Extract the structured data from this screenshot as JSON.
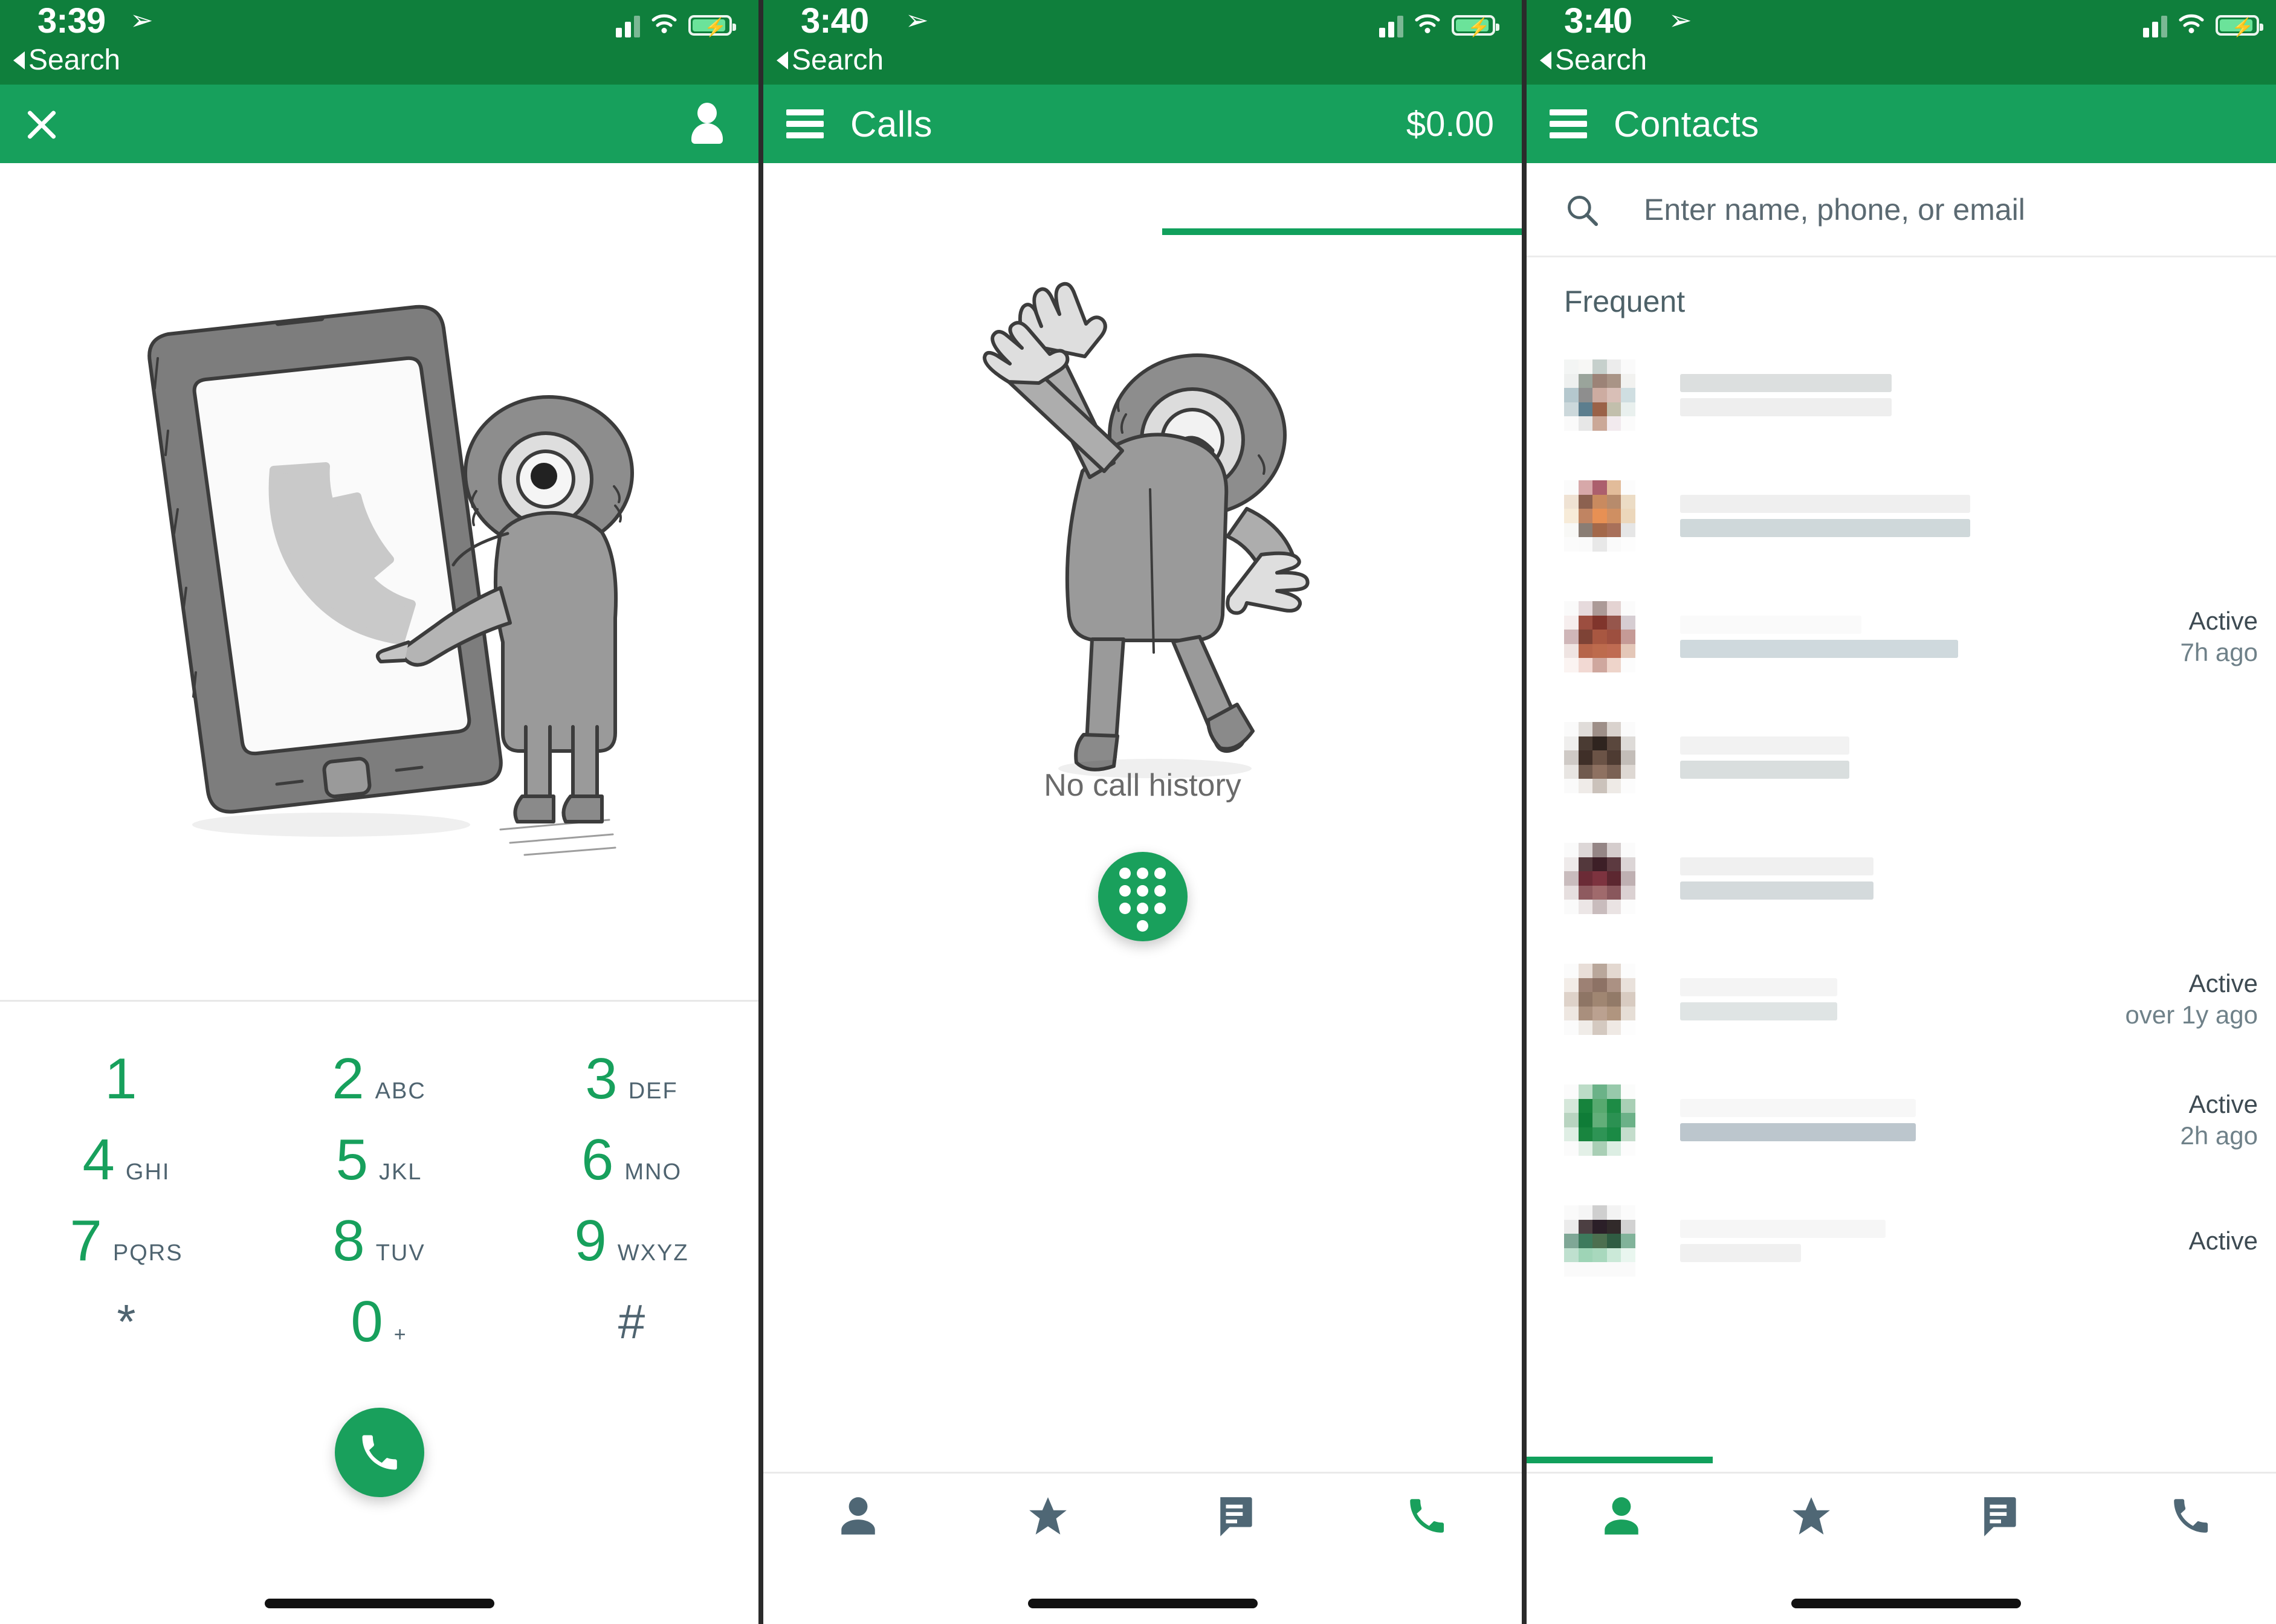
{
  "colors": {
    "status_bar_green": "#0F7F3C",
    "app_bar_green": "#17A05C",
    "accent_green": "#19A05C",
    "tab_inactive": "#4F6775",
    "text_muted": "#6a6a6a"
  },
  "panels": [
    {
      "id": "dialer",
      "status": {
        "time": "3:39",
        "back_label": "Search",
        "location_icon": "location-arrow-icon",
        "signal_icon": "cellular-signal-icon",
        "wifi_icon": "wifi-icon",
        "battery_icon": "battery-charging-icon"
      },
      "appbar": {
        "close_icon": "close-icon",
        "person_icon": "person-icon",
        "title": ""
      },
      "illustration": "person-pointing-at-phone-illustration",
      "dialpad": {
        "keys": [
          {
            "num": "1",
            "letters": ""
          },
          {
            "num": "2",
            "letters": "ABC"
          },
          {
            "num": "3",
            "letters": "DEF"
          },
          {
            "num": "4",
            "letters": "GHI"
          },
          {
            "num": "5",
            "letters": "JKL"
          },
          {
            "num": "6",
            "letters": "MNO"
          },
          {
            "num": "7",
            "letters": "PQRS"
          },
          {
            "num": "8",
            "letters": "TUV"
          },
          {
            "num": "9",
            "letters": "WXYZ"
          },
          {
            "num": "*",
            "letters": ""
          },
          {
            "num": "0",
            "letters": "+"
          },
          {
            "num": "#",
            "letters": ""
          }
        ],
        "call_button_icon": "phone-call-icon"
      }
    },
    {
      "id": "calls",
      "status": {
        "time": "3:40",
        "back_label": "Search"
      },
      "appbar": {
        "menu_icon": "hamburger-menu-icon",
        "title": "Calls",
        "balance": "$0.00"
      },
      "illustration": "celebrating-character-illustration",
      "empty_state": "No call history",
      "fab": {
        "icon": "dialpad-icon"
      },
      "tabs": [
        {
          "name": "contacts",
          "icon": "person-icon",
          "active": false
        },
        {
          "name": "favorites",
          "icon": "star-icon",
          "active": false
        },
        {
          "name": "messages",
          "icon": "message-icon",
          "active": false
        },
        {
          "name": "calls",
          "icon": "phone-icon",
          "active": true
        }
      ]
    },
    {
      "id": "contacts",
      "status": {
        "time": "3:40",
        "back_label": "Search"
      },
      "appbar": {
        "menu_icon": "hamburger-menu-icon",
        "title": "Contacts"
      },
      "search": {
        "icon": "search-icon",
        "placeholder": "Enter name, phone, or email",
        "value": ""
      },
      "section_header": "Frequent",
      "rows": [
        {
          "avatar_tone": "mixed-cool",
          "name_redacted": true,
          "status": "",
          "time": ""
        },
        {
          "avatar_tone": "warm-orange",
          "name_redacted": true,
          "status": "",
          "time": ""
        },
        {
          "avatar_tone": "red-brown",
          "name_redacted": true,
          "status": "Active",
          "time": "7h ago"
        },
        {
          "avatar_tone": "dark-brown",
          "name_redacted": true,
          "status": "",
          "time": ""
        },
        {
          "avatar_tone": "maroon",
          "name_redacted": true,
          "status": "",
          "time": ""
        },
        {
          "avatar_tone": "tan",
          "name_redacted": true,
          "status": "Active",
          "time": "over 1y ago"
        },
        {
          "avatar_tone": "green",
          "name_redacted": true,
          "status": "Active",
          "time": "2h ago"
        },
        {
          "avatar_tone": "dark",
          "name_redacted": true,
          "status": "Active",
          "time": ""
        }
      ],
      "tabs": [
        {
          "name": "contacts",
          "icon": "person-icon",
          "active": true
        },
        {
          "name": "favorites",
          "icon": "star-icon",
          "active": false
        },
        {
          "name": "messages",
          "icon": "message-icon",
          "active": false
        },
        {
          "name": "calls",
          "icon": "phone-icon",
          "active": false
        }
      ]
    }
  ]
}
